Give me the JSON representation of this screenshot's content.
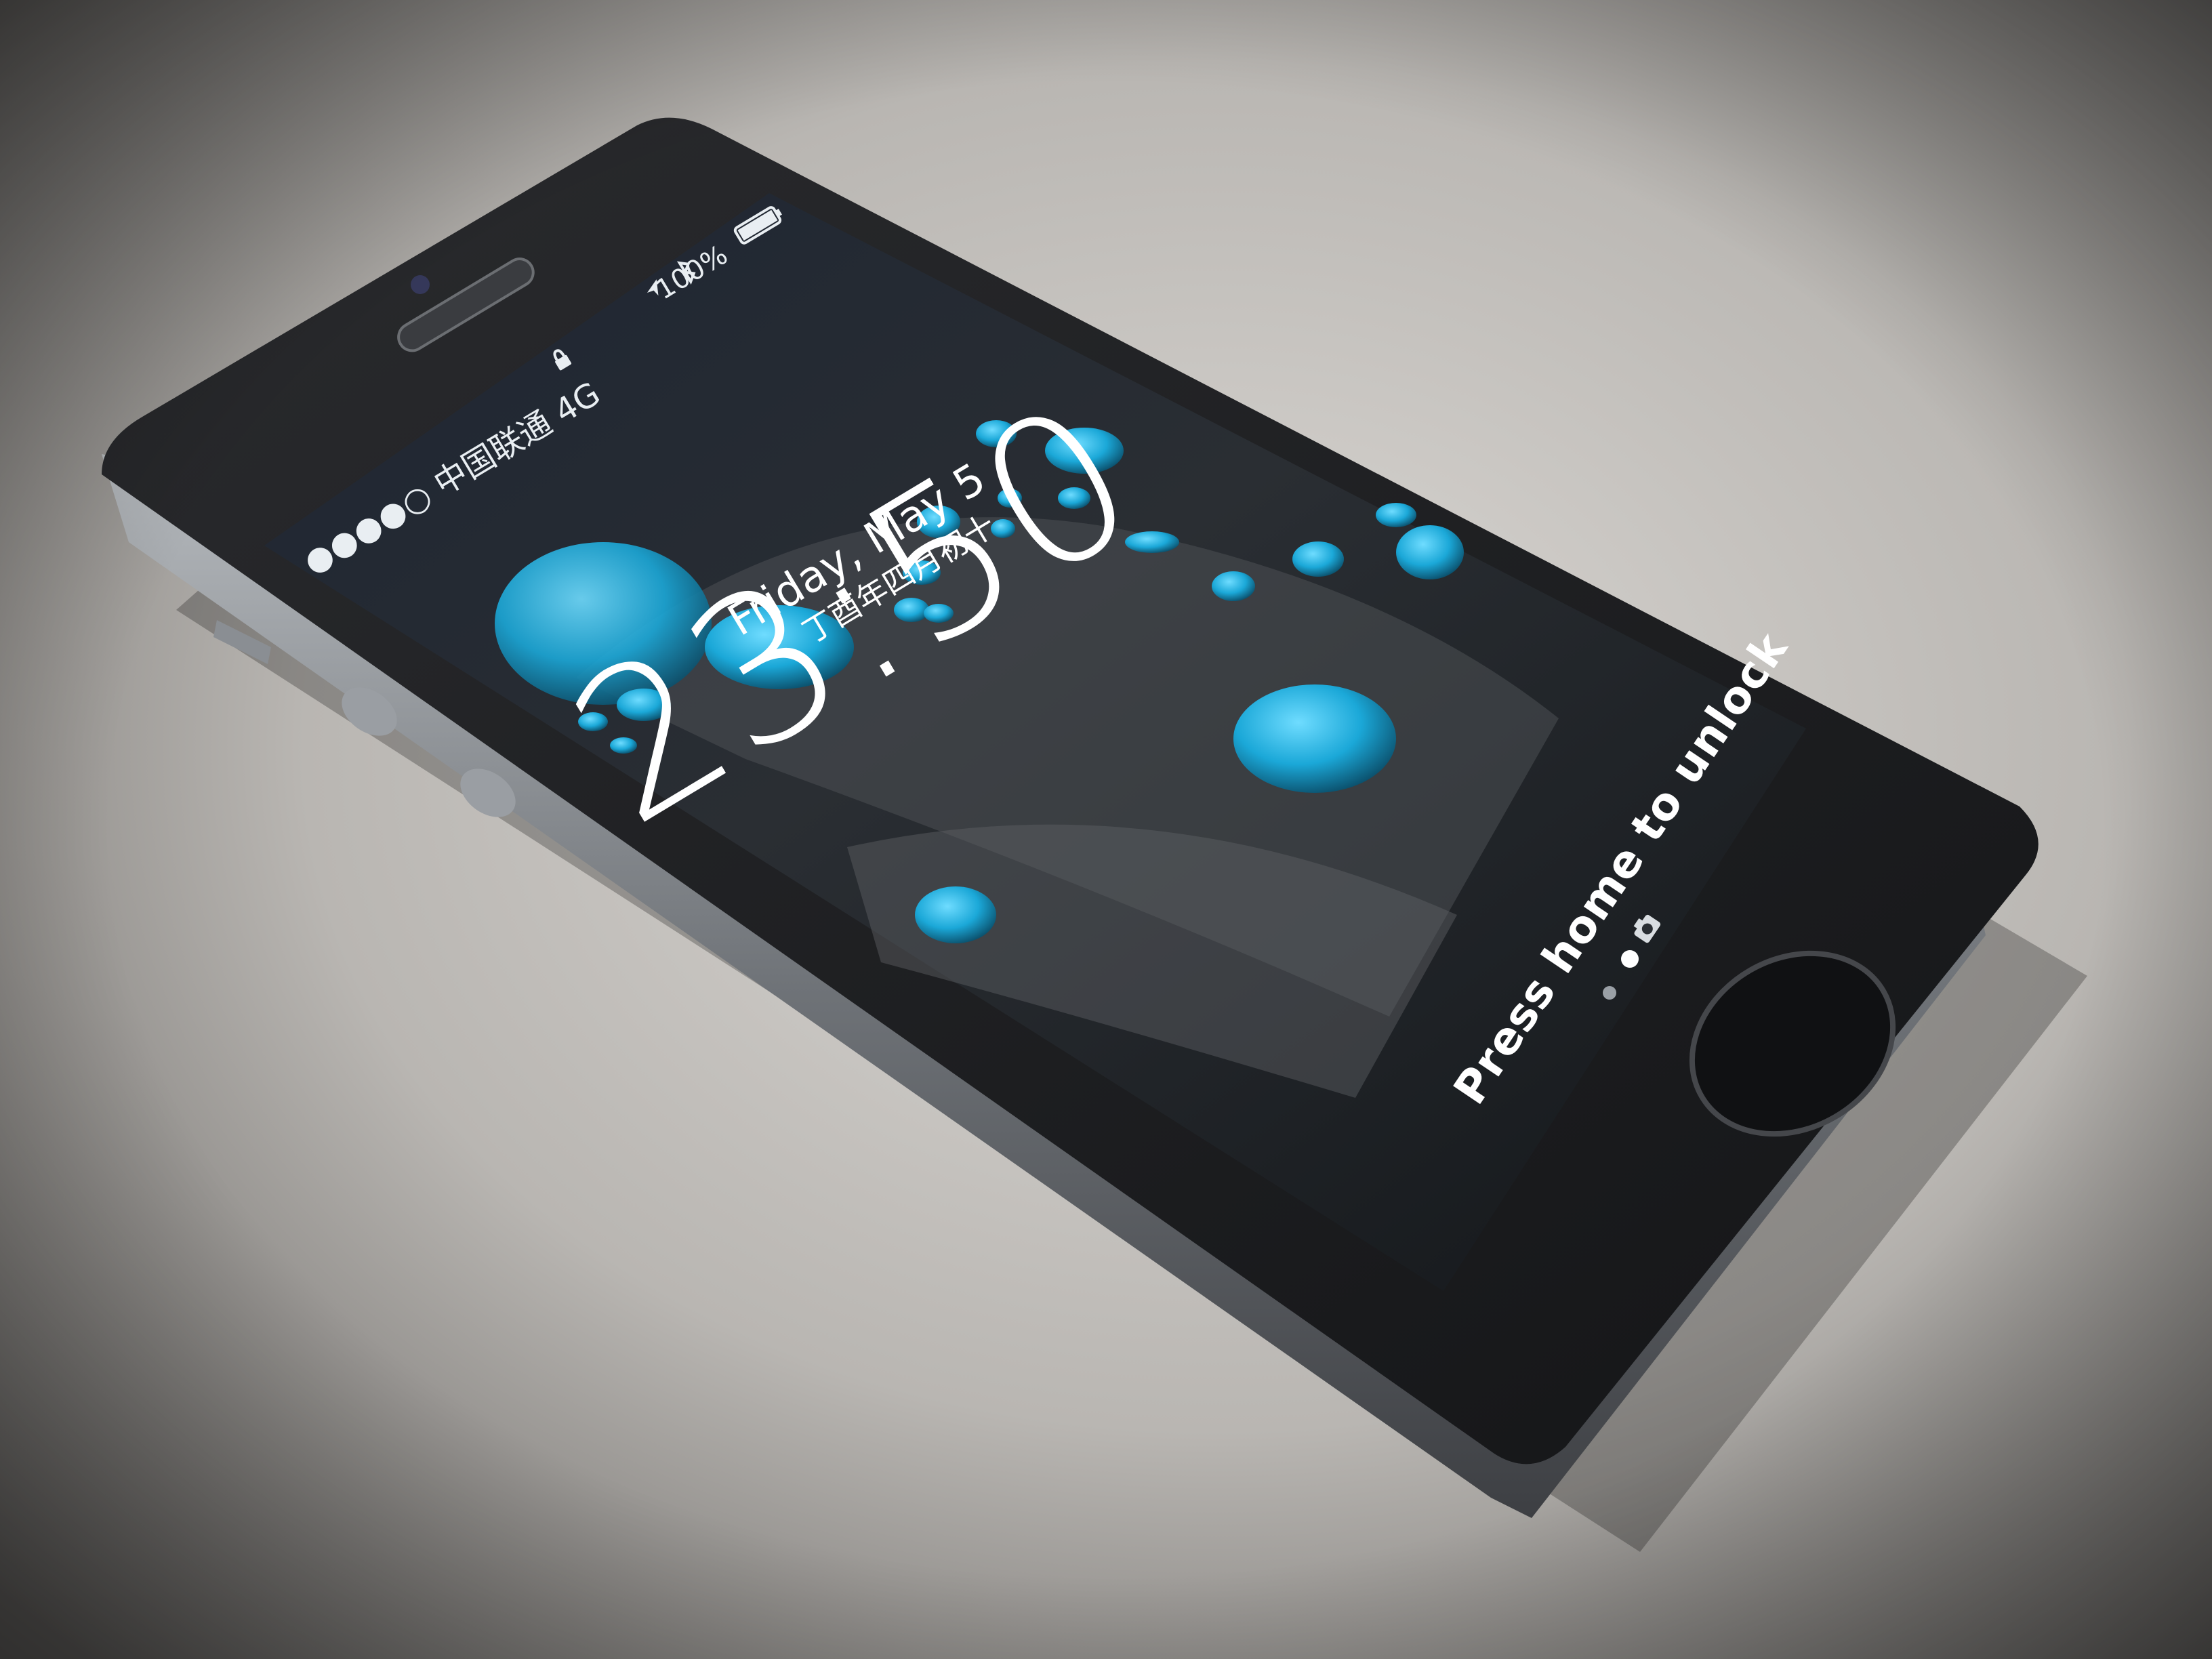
{
  "status_bar": {
    "carrier_text": "●●●●○ 中国联通  4G",
    "battery_text": "100%"
  },
  "lock_screen": {
    "time": "23:50",
    "date": "Friday, May 5",
    "lunar_date": "丁酉年四月初十",
    "unlock_hint": "Press home to unlock"
  },
  "icons": [
    "camera-icon",
    "bluetooth-icon",
    "location-icon",
    "lock-icon",
    "battery-icon"
  ],
  "colors": {
    "background": "#8f8c88",
    "phone_body": "#1c1d20",
    "screen_dark": "#101418",
    "water_drop": "#1ba8d8"
  }
}
